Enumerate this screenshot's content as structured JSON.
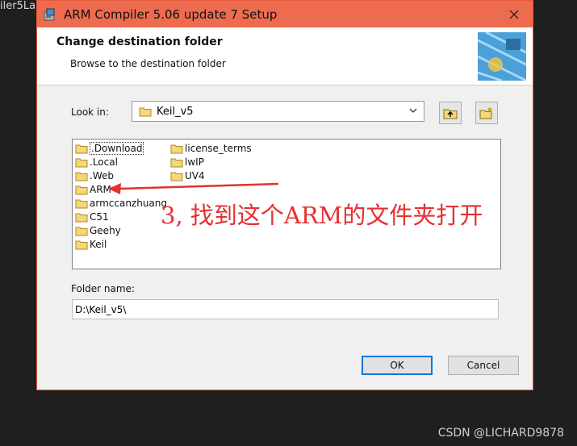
{
  "background": {
    "left_text": "iler5La"
  },
  "window": {
    "title": "ARM Compiler 5.06 update 7 Setup",
    "icons": {
      "app": "installer-icon",
      "close": "close-icon"
    }
  },
  "header": {
    "title": "Change destination folder",
    "subtitle": "Browse to the destination folder"
  },
  "look_in": {
    "label": "Look in:",
    "value": "Keil_v5"
  },
  "files": [
    {
      "name": ".Download",
      "selected": true
    },
    {
      "name": ".Local"
    },
    {
      "name": ".Web"
    },
    {
      "name": "ARM"
    },
    {
      "name": "armccanzhuang"
    },
    {
      "name": "C51"
    },
    {
      "name": "Geehy"
    },
    {
      "name": "Keil"
    },
    {
      "name": "license_terms"
    },
    {
      "name": "lwIP"
    },
    {
      "name": "UV4"
    }
  ],
  "folder_name": {
    "label": "Folder name:",
    "value": "D:\\Keil_v5\\"
  },
  "buttons": {
    "ok": "OK",
    "cancel": "Cancel"
  },
  "annotation": {
    "text": "3, 找到这个ARM的文件夹打开"
  },
  "watermark": "CSDN @LICHARD9878",
  "colors": {
    "titlebar": "#ed6b4f",
    "annotation": "#e53030",
    "default_button_border": "#0078d7"
  }
}
